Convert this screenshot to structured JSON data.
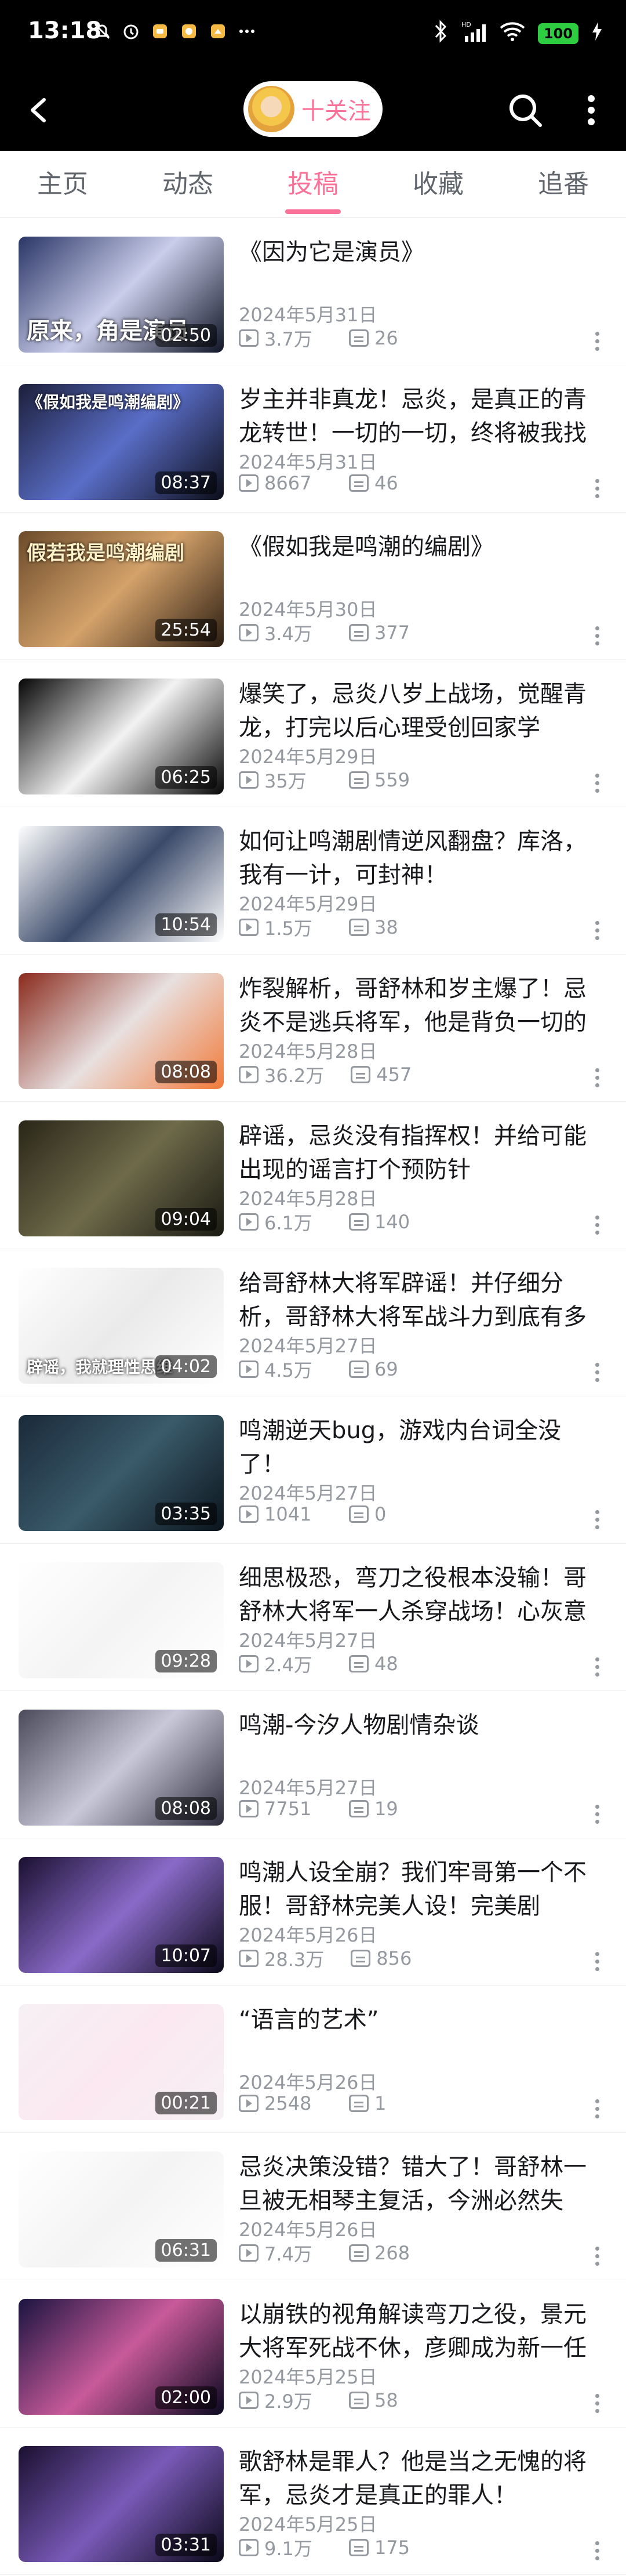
{
  "status_bar": {
    "time": "13:18",
    "battery": "100",
    "signal": "HD"
  },
  "header": {
    "follow_label": "十关注"
  },
  "tabs": [
    {
      "label": "主页",
      "active": false
    },
    {
      "label": "动态",
      "active": false
    },
    {
      "label": "投稿",
      "active": true
    },
    {
      "label": "收藏",
      "active": false
    },
    {
      "label": "追番",
      "active": false
    }
  ],
  "videos": [
    {
      "title": "《因为它是演员》",
      "date": "2024年5月31日",
      "views": "3.7万",
      "danmaku": "26",
      "duration": "02:50",
      "overlay": "原来，角是演员",
      "colors": [
        "#2a3566",
        "#c9cdea",
        "#101426"
      ]
    },
    {
      "title": "岁主并非真龙！忌炎，是真正的青龙转世！一切的一切，终将被我找到…",
      "date": "2024年5月31日",
      "views": "8667",
      "danmaku": "46",
      "duration": "08:37",
      "overlay": "《假如我是鸣潮编剧》",
      "colors": [
        "#1c1f3a",
        "#5a6ec8",
        "#0c0d18"
      ]
    },
    {
      "title": "《假如我是鸣潮的编剧》",
      "date": "2024年5月30日",
      "views": "3.4万",
      "danmaku": "377",
      "duration": "25:54",
      "overlay": "假若我是鸣潮编剧",
      "colors": [
        "#6b4a2a",
        "#d4a26a",
        "#2b1d12"
      ]
    },
    {
      "title": "爆笑了，忌炎八岁上战场，觉醒青龙，打完以后心理受创回家学医，…",
      "date": "2024年5月29日",
      "views": "35万",
      "danmaku": "559",
      "duration": "06:25",
      "overlay": "",
      "colors": [
        "#050505",
        "#f2f2f2",
        "#050505"
      ]
    },
    {
      "title": "如何让鸣潮剧情逆风翻盘？库洛，我有一计，可封神！",
      "date": "2024年5月29日",
      "views": "1.5万",
      "danmaku": "38",
      "duration": "10:54",
      "overlay": "",
      "colors": [
        "#ffffff",
        "#3b4a6a",
        "#ffffff"
      ]
    },
    {
      "title": "炸裂解析，哥舒林和岁主爆了！忌炎不是逃兵将军，他是背负一切的男…",
      "date": "2024年5月28日",
      "views": "36.2万",
      "danmaku": "457",
      "duration": "08:08",
      "overlay": "",
      "colors": [
        "#8a2a1c",
        "#e8e0e0",
        "#f27a3a"
      ]
    },
    {
      "title": "辟谣，忌炎没有指挥权！并给可能出现的谣言打个预防针",
      "date": "2024年5月28日",
      "views": "6.1万",
      "danmaku": "140",
      "duration": "09:04",
      "overlay": "",
      "colors": [
        "#2a2618",
        "#6e6a4a",
        "#1a1a12"
      ]
    },
    {
      "title": "给哥舒林大将军辟谣！并仔细分析，哥舒林大将军战斗力到底有多强",
      "date": "2024年5月27日",
      "views": "4.5万",
      "danmaku": "69",
      "duration": "04:02",
      "overlay": "辟谣，我就理性思维",
      "colors": [
        "#ffffff",
        "#eaeaea",
        "#ffffff"
      ]
    },
    {
      "title": "鸣潮逆天bug，游戏内台词全没了！",
      "date": "2024年5月27日",
      "views": "1041",
      "danmaku": "0",
      "duration": "03:35",
      "overlay": "",
      "colors": [
        "#1a2a3a",
        "#3a5a6a",
        "#0a141c"
      ]
    },
    {
      "title": "细思极恐，弯刀之役根本没输！哥舒林大将军一人杀穿战场！心灰意冷…",
      "date": "2024年5月27日",
      "views": "2.4万",
      "danmaku": "48",
      "duration": "09:28",
      "overlay": "",
      "colors": [
        "#ffffff",
        "#f4f4f4",
        "#ffffff"
      ]
    },
    {
      "title": "鸣潮-今汐人物剧情杂谈",
      "date": "2024年5月27日",
      "views": "7751",
      "danmaku": "19",
      "duration": "08:08",
      "overlay": "",
      "colors": [
        "#4a4a5a",
        "#c8c8d8",
        "#2a2a3a"
      ]
    },
    {
      "title": "鸣潮人设全崩？我们牢哥第一个不服！哥舒林完美人设！完美剧情，…",
      "date": "2024年5月26日",
      "views": "28.3万",
      "danmaku": "856",
      "duration": "10:07",
      "overlay": "",
      "colors": [
        "#1a1030",
        "#8a6ac8",
        "#0a0818"
      ]
    },
    {
      "title": "“语言的艺术”",
      "date": "2024年5月26日",
      "views": "2548",
      "danmaku": "1",
      "duration": "00:21",
      "overlay": "",
      "colors": [
        "#f6f0f4",
        "#fbe8f0",
        "#f6f0f4"
      ]
    },
    {
      "title": "忌炎决策没错？错大了！哥舒林一旦被无相琴主复活，今洲必然失守！",
      "date": "2024年5月26日",
      "views": "7.4万",
      "danmaku": "268",
      "duration": "06:31",
      "overlay": "",
      "colors": [
        "#ffffff",
        "#f4f4f4",
        "#ffffff"
      ]
    },
    {
      "title": "以崩铁的视角解读弯刀之役，景元大将军死战不休，彦卿成为新一任将军",
      "date": "2024年5月25日",
      "views": "2.9万",
      "danmaku": "58",
      "duration": "02:00",
      "overlay": "",
      "colors": [
        "#1a1440",
        "#c85a9a",
        "#0a0820"
      ]
    },
    {
      "title": "歌舒林是罪人？他是当之无愧的将军，忌炎才是真正的罪人！",
      "date": "2024年5月25日",
      "views": "9.1万",
      "danmaku": "175",
      "duration": "03:31",
      "overlay": "",
      "colors": [
        "#1a1030",
        "#7a5ab8",
        "#0a0818"
      ]
    }
  ]
}
